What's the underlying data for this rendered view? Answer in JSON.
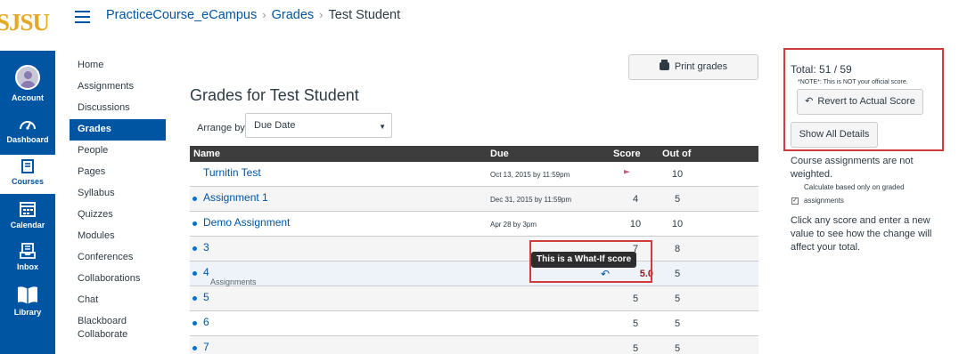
{
  "brand": {
    "logo_text": "SJSU"
  },
  "global_nav": [
    {
      "label": "Account",
      "icon": "account-avatar"
    },
    {
      "label": "Dashboard",
      "icon": "dashboard-icon"
    },
    {
      "label": "Courses",
      "icon": "courses-icon",
      "active": true
    },
    {
      "label": "Calendar",
      "icon": "calendar-icon"
    },
    {
      "label": "Inbox",
      "icon": "inbox-icon"
    },
    {
      "label": "Library",
      "icon": "library-icon"
    }
  ],
  "breadcrumb": {
    "course": "PracticeCourse_eCampus",
    "section": "Grades",
    "current": "Test Student"
  },
  "course_nav": [
    "Home",
    "Assignments",
    "Discussions",
    "Grades",
    "People",
    "Pages",
    "Syllabus",
    "Quizzes",
    "Modules",
    "Conferences",
    "Collaborations",
    "Chat",
    "Blackboard Collaborate"
  ],
  "page": {
    "title": "Grades for Test Student",
    "print_label": "Print grades",
    "arrange_label": "Arrange by",
    "arrange_value": "Due Date"
  },
  "table": {
    "headers": {
      "name": "Name",
      "due": "Due",
      "score": "Score",
      "out_of": "Out of"
    },
    "rows": [
      {
        "name": "Turnitin Test",
        "due": "Oct 13, 2015 by 11:59pm",
        "score": "",
        "out_of": "10",
        "dot": false,
        "flag": true
      },
      {
        "name": "Assignment 1",
        "due": "Dec 31, 2015 by 11:59pm",
        "score": "4",
        "out_of": "5",
        "dot": true
      },
      {
        "name": "Demo Assignment",
        "due": "Apr 28 by 3pm",
        "score": "10",
        "out_of": "10",
        "dot": true
      },
      {
        "name": "3",
        "due": "",
        "score": "7",
        "out_of": "8",
        "dot": true
      },
      {
        "name": "4",
        "sub": "Assignments",
        "due": "",
        "score": "5.0",
        "out_of": "5",
        "dot": true,
        "what_if": true
      },
      {
        "name": "5",
        "due": "",
        "score": "5",
        "out_of": "5",
        "dot": true
      },
      {
        "name": "6",
        "due": "",
        "score": "5",
        "out_of": "5",
        "dot": true
      },
      {
        "name": "7",
        "due": "",
        "score": "5",
        "out_of": "5",
        "dot": true
      }
    ]
  },
  "tooltip": "This is a What-If score",
  "sidebar": {
    "total": "Total: 51 / 59",
    "note": "*NOTE*: This is NOT your official score.",
    "revert_label": "Revert to Actual Score",
    "show_details_label": "Show All Details",
    "weight_text": "Course assignments are not weighted.",
    "calc_text": "Calculate based only on graded",
    "calc_text2": "assignments",
    "calc_checked": true,
    "help_text": "Click any score and enter a new value to see how the change will affect your total."
  },
  "colors": {
    "brand_blue": "#0055a2",
    "logo_gold": "#e5a823",
    "highlight_red": "#d13b3b"
  }
}
